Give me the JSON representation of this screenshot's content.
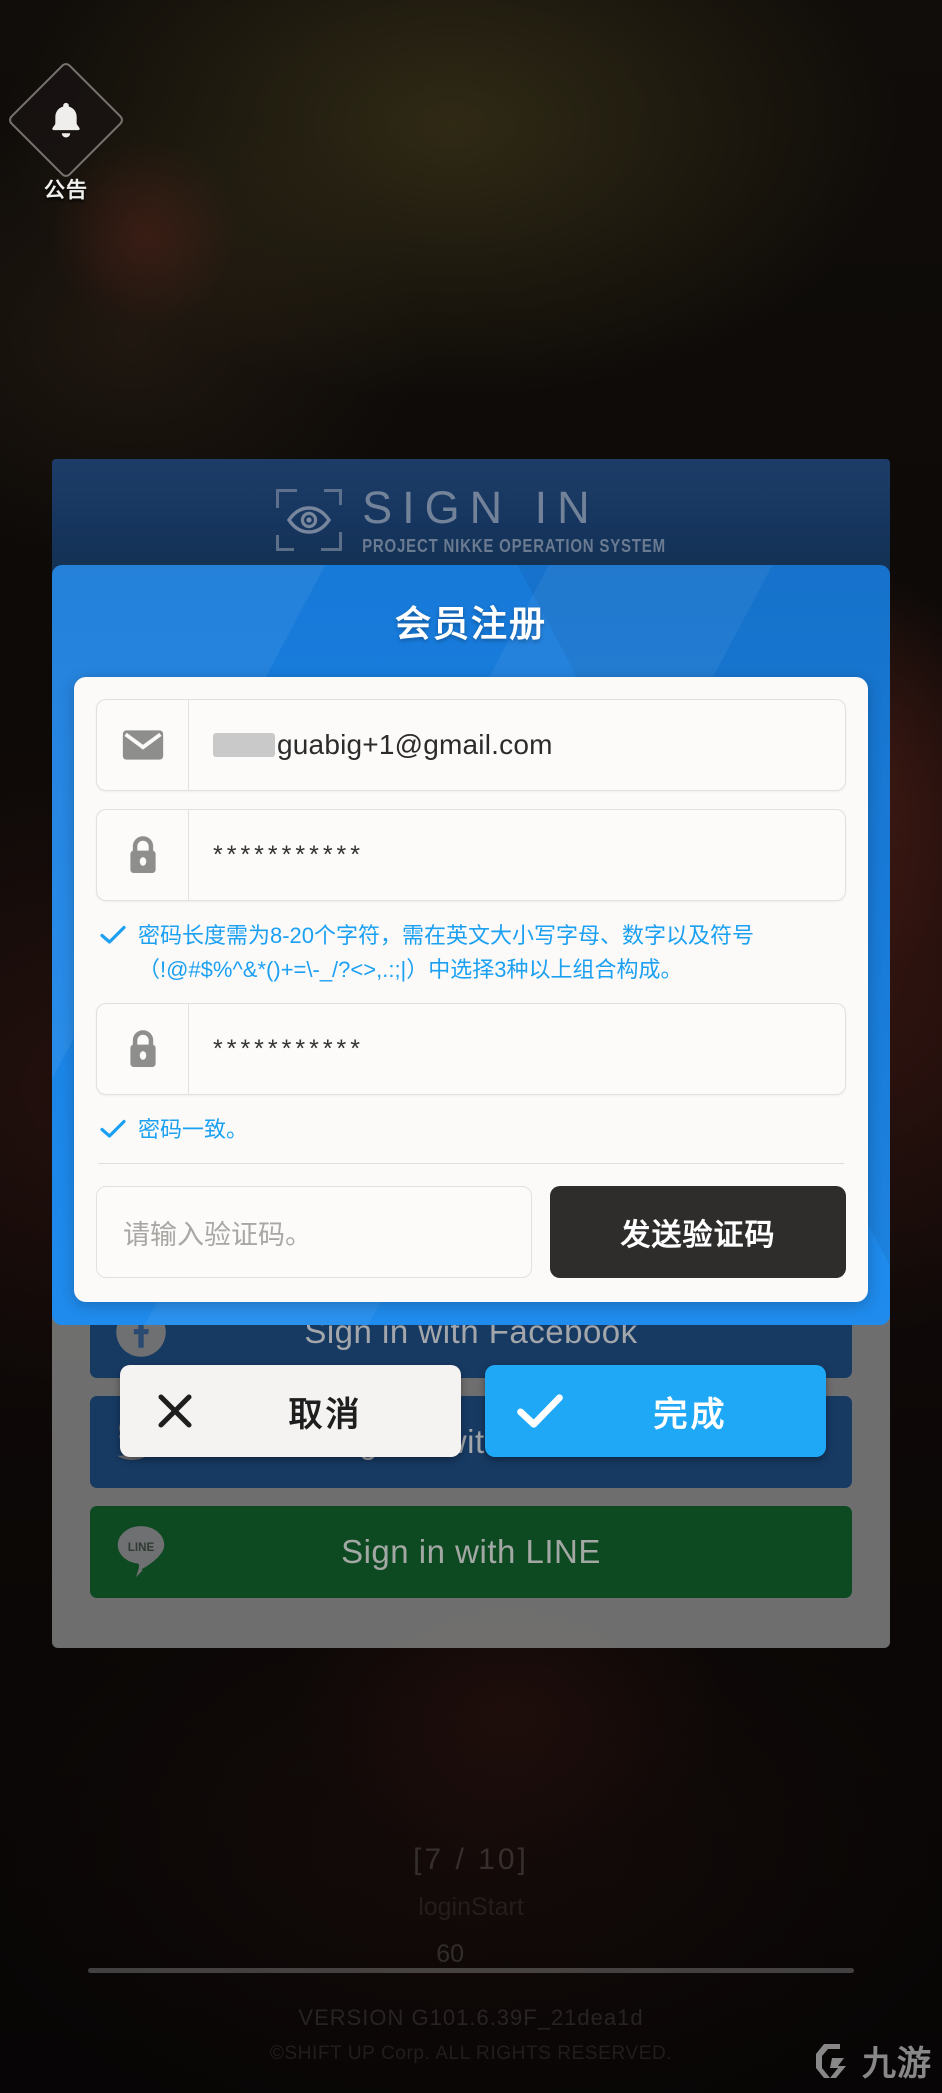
{
  "notice": {
    "label": "公告",
    "icon": "bell-icon"
  },
  "sign_in_header": {
    "title": "SIGN IN",
    "subtitle": "PROJECT NIKKE OPERATION SYSTEM",
    "icon": "eye-target-icon"
  },
  "modal": {
    "title": "会员注册",
    "email_field": {
      "icon": "mail-icon",
      "value": "guabig+1@gmail.com",
      "redacted_prefix": true
    },
    "password_field": {
      "icon": "lock-icon",
      "value": "***********"
    },
    "password_hint": {
      "icon": "check-icon",
      "text": "密码长度需为8-20个字符，需在英文大小写字母、数字以及符号（!@#$%^&*()+=\\-_/?<>,.:;|）中选择3种以上组合构成。",
      "color": "#1ca0f2"
    },
    "confirm_password_field": {
      "icon": "lock-icon",
      "value": "***********"
    },
    "match_hint": {
      "icon": "check-icon",
      "text": "密码一致。",
      "color": "#1ca0f2"
    },
    "verification_code_input": {
      "placeholder": "请输入验证码。",
      "value": ""
    },
    "send_code_button": {
      "label": "发送验证码"
    }
  },
  "actions": {
    "cancel": {
      "label": "取消",
      "icon": "close-icon"
    },
    "confirm": {
      "label": "完成",
      "icon": "check-icon",
      "color": "#1fa8f5"
    }
  },
  "login_panel": {
    "buttons": [
      {
        "label": "Sign in with Facebook",
        "icon": "facebook-icon",
        "color": "#173a63"
      },
      {
        "label": "Sign in with Twitter",
        "icon": "twitter-icon",
        "color": "#173a63"
      },
      {
        "label": "Sign in with LINE",
        "icon": "line-icon",
        "color": "#0d4a22"
      }
    ]
  },
  "footer": {
    "page_indicator": "[7 / 10]",
    "scene": "loginStart",
    "fps": "60",
    "version": "VERSION  G101.6.39F_21dea1d",
    "copyright": "©SHIFT UP Corp. ALL RIGHTS  RESERVED.",
    "watermark": "九游"
  }
}
